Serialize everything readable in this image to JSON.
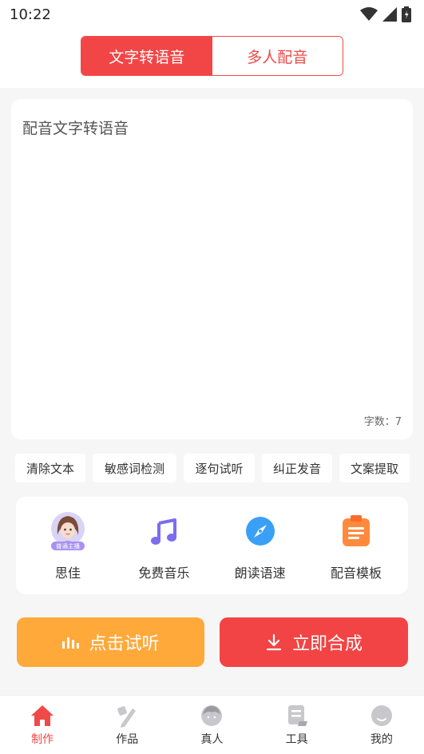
{
  "status": {
    "time": "10:22"
  },
  "tabs": [
    {
      "label": "文字转语音",
      "active": true
    },
    {
      "label": "多人配音",
      "active": false
    }
  ],
  "editor": {
    "text": "配音文字转语音",
    "count_label": "字数：7"
  },
  "chips": [
    "清除文本",
    "敏感词检测",
    "逐句试听",
    "纠正发音",
    "文案提取"
  ],
  "tools": [
    {
      "label": "思佳",
      "icon": "voice-anchor-avatar",
      "badge": "普通主播"
    },
    {
      "label": "免费音乐",
      "icon": "music-note-icon"
    },
    {
      "label": "朗读语速",
      "icon": "compass-icon"
    },
    {
      "label": "配音模板",
      "icon": "clipboard-icon"
    }
  ],
  "buttons": {
    "listen": "点击试听",
    "make": "立即合成"
  },
  "nav": [
    {
      "label": "制作",
      "icon": "home-icon",
      "active": true
    },
    {
      "label": "作品",
      "icon": "works-icon",
      "active": false
    },
    {
      "label": "真人",
      "icon": "person-icon",
      "active": false
    },
    {
      "label": "工具",
      "icon": "tools-icon",
      "active": false
    },
    {
      "label": "我的",
      "icon": "profile-icon",
      "active": false
    }
  ],
  "colors": {
    "accent": "#f24646",
    "orange": "#ffa93b",
    "tool_purple": "#7b6cf0",
    "tool_blue": "#3aa0f5",
    "tool_orange": "#ff8a3d",
    "nav_inactive": "#c8c8cc"
  }
}
